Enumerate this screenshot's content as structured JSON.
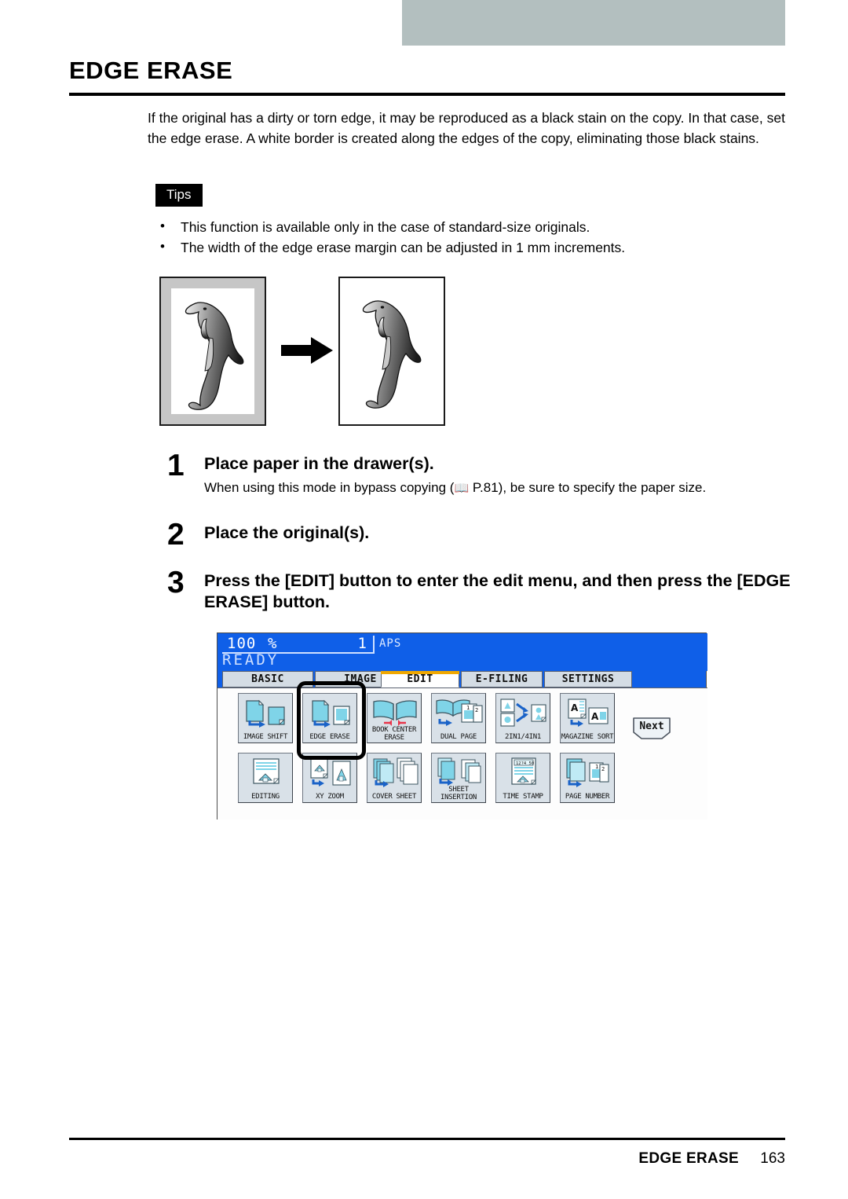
{
  "page": {
    "title": "EDGE ERASE",
    "intro": "If the original has a dirty or torn edge, it may be reproduced as a black stain on the copy. In that case, set the edge erase. A white border is created along the edges of the copy, eliminating those black stains.",
    "footer_title": "EDGE ERASE",
    "footer_page": "163"
  },
  "tips": {
    "label": "Tips",
    "bullet_glyph": "•",
    "items": [
      "This function is available only in the case of standard-size originals.",
      "The width of the edge erase margin can be adjusted in 1 mm increments."
    ]
  },
  "illustration": {
    "before_caption": "original with dirty edge",
    "after_caption": "copy with white border",
    "arrow": "arrow-right"
  },
  "steps": [
    {
      "number": "1",
      "heading": "Place paper in the drawer(s).",
      "sub_before": "When using this mode in bypass copying (",
      "sub_icon": "📖",
      "sub_ref": " P.81",
      "sub_after": "), be sure to specify the paper size."
    },
    {
      "number": "2",
      "heading": "Place the original(s).",
      "sub_before": "",
      "sub_icon": "",
      "sub_ref": "",
      "sub_after": ""
    },
    {
      "number": "3",
      "heading": "Press the [EDIT] button to enter the edit menu, and then press the [EDGE ERASE] button.",
      "sub_before": "",
      "sub_icon": "",
      "sub_ref": "",
      "sub_after": ""
    }
  ],
  "lcd": {
    "status": {
      "ratio_value": "100",
      "ratio_unit": "%",
      "copy_count": "1",
      "paper_mode": "APS",
      "state": "READY"
    },
    "tabs": [
      {
        "label": "BASIC",
        "selected": false
      },
      {
        "label": "IMAGE",
        "selected": false
      },
      {
        "label": "EDIT",
        "selected": true
      },
      {
        "label": "E-FILING",
        "selected": false
      },
      {
        "label": "SETTINGS",
        "selected": false
      }
    ],
    "buttons_row1": [
      {
        "label": "IMAGE SHIFT",
        "label2": "",
        "selected": false,
        "icon": "image-shift-icon"
      },
      {
        "label": "EDGE ERASE",
        "label2": "",
        "selected": true,
        "icon": "edge-erase-icon"
      },
      {
        "label": "BOOK CENTER",
        "label2": "ERASE",
        "selected": false,
        "icon": "book-center-erase-icon"
      },
      {
        "label": "DUAL PAGE",
        "label2": "",
        "selected": false,
        "icon": "dual-page-icon"
      },
      {
        "label": "2IN1/4IN1",
        "label2": "",
        "selected": false,
        "icon": "2in1-4in1-icon"
      },
      {
        "label": "MAGAZINE SORT",
        "label2": "",
        "selected": false,
        "icon": "magazine-sort-icon"
      }
    ],
    "buttons_row2": [
      {
        "label": "EDITING",
        "label2": "",
        "selected": false,
        "icon": "editing-icon"
      },
      {
        "label": "XY ZOOM",
        "label2": "",
        "selected": false,
        "icon": "xy-zoom-icon"
      },
      {
        "label": "COVER SHEET",
        "label2": "",
        "selected": false,
        "icon": "cover-sheet-icon"
      },
      {
        "label": "SHEET",
        "label2": "INSERTION",
        "selected": false,
        "icon": "sheet-insertion-icon"
      },
      {
        "label": "TIME STAMP",
        "label2": "",
        "selected": false,
        "icon": "time-stamp-icon"
      },
      {
        "label": "PAGE NUMBER",
        "label2": "",
        "selected": false,
        "icon": "page-number-icon"
      }
    ],
    "next_label": "Next",
    "colors": {
      "screen_blue": "#0f5fe8",
      "tab_selected_accent": "#f0a800",
      "button_face": "#d9e1e8",
      "icon_cyan": "#7fd4e8",
      "icon_arrow_blue": "#1a63c8",
      "icon_red": "#e8354a"
    }
  },
  "header_band_color": "#b3bfbf"
}
